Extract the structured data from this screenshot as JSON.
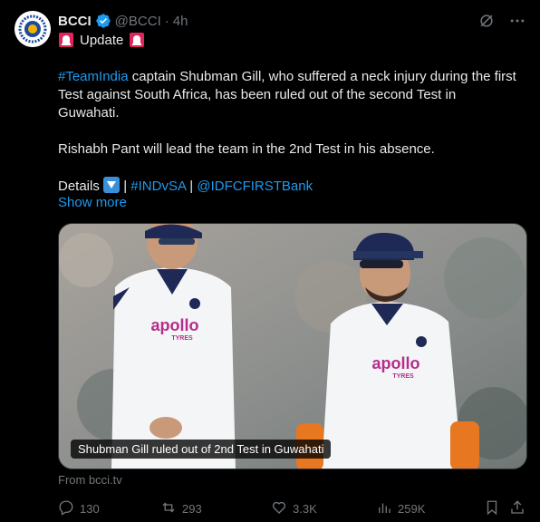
{
  "post": {
    "author_name": "BCCI",
    "handle": "@BCCI",
    "separator": "·",
    "time": "4h",
    "update_label": "Update",
    "text": {
      "hashtag_team": "#TeamIndia",
      "para1_rest": " captain Shubman Gill, who suffered a neck injury during the first Test against South Africa, has been ruled out of the second Test in Guwahati.",
      "para2": "Rishabh Pant will lead the team in the 2nd Test in his absence.",
      "details_label": "Details",
      "pipe1": " | ",
      "hashtag_series": "#INDvSA",
      "pipe2": " | ",
      "mention_sponsor": "@IDFCFIRSTBank"
    },
    "show_more": "Show more",
    "media": {
      "caption": "Shubman Gill ruled out of 2nd Test in Guwahati",
      "jersey_text_left": "apollo",
      "jersey_sub_left": "TYRES",
      "jersey_text_right": "apollo",
      "jersey_sub_right": "TYRES"
    },
    "source": "From bcci.tv",
    "stats": {
      "replies": "130",
      "reposts": "293",
      "likes": "3.3K",
      "views": "259K"
    }
  },
  "colors": {
    "background": "#000000",
    "text": "#e7e9ea",
    "muted": "#71767b",
    "link": "#1d9bf0",
    "verified": "#1d9bf0"
  },
  "icons": [
    "verified-badge-icon",
    "grok-icon",
    "more-icon",
    "siren-icon",
    "down-arrow-icon",
    "reply-icon",
    "repost-icon",
    "like-icon",
    "views-icon",
    "bookmark-icon",
    "share-icon"
  ]
}
